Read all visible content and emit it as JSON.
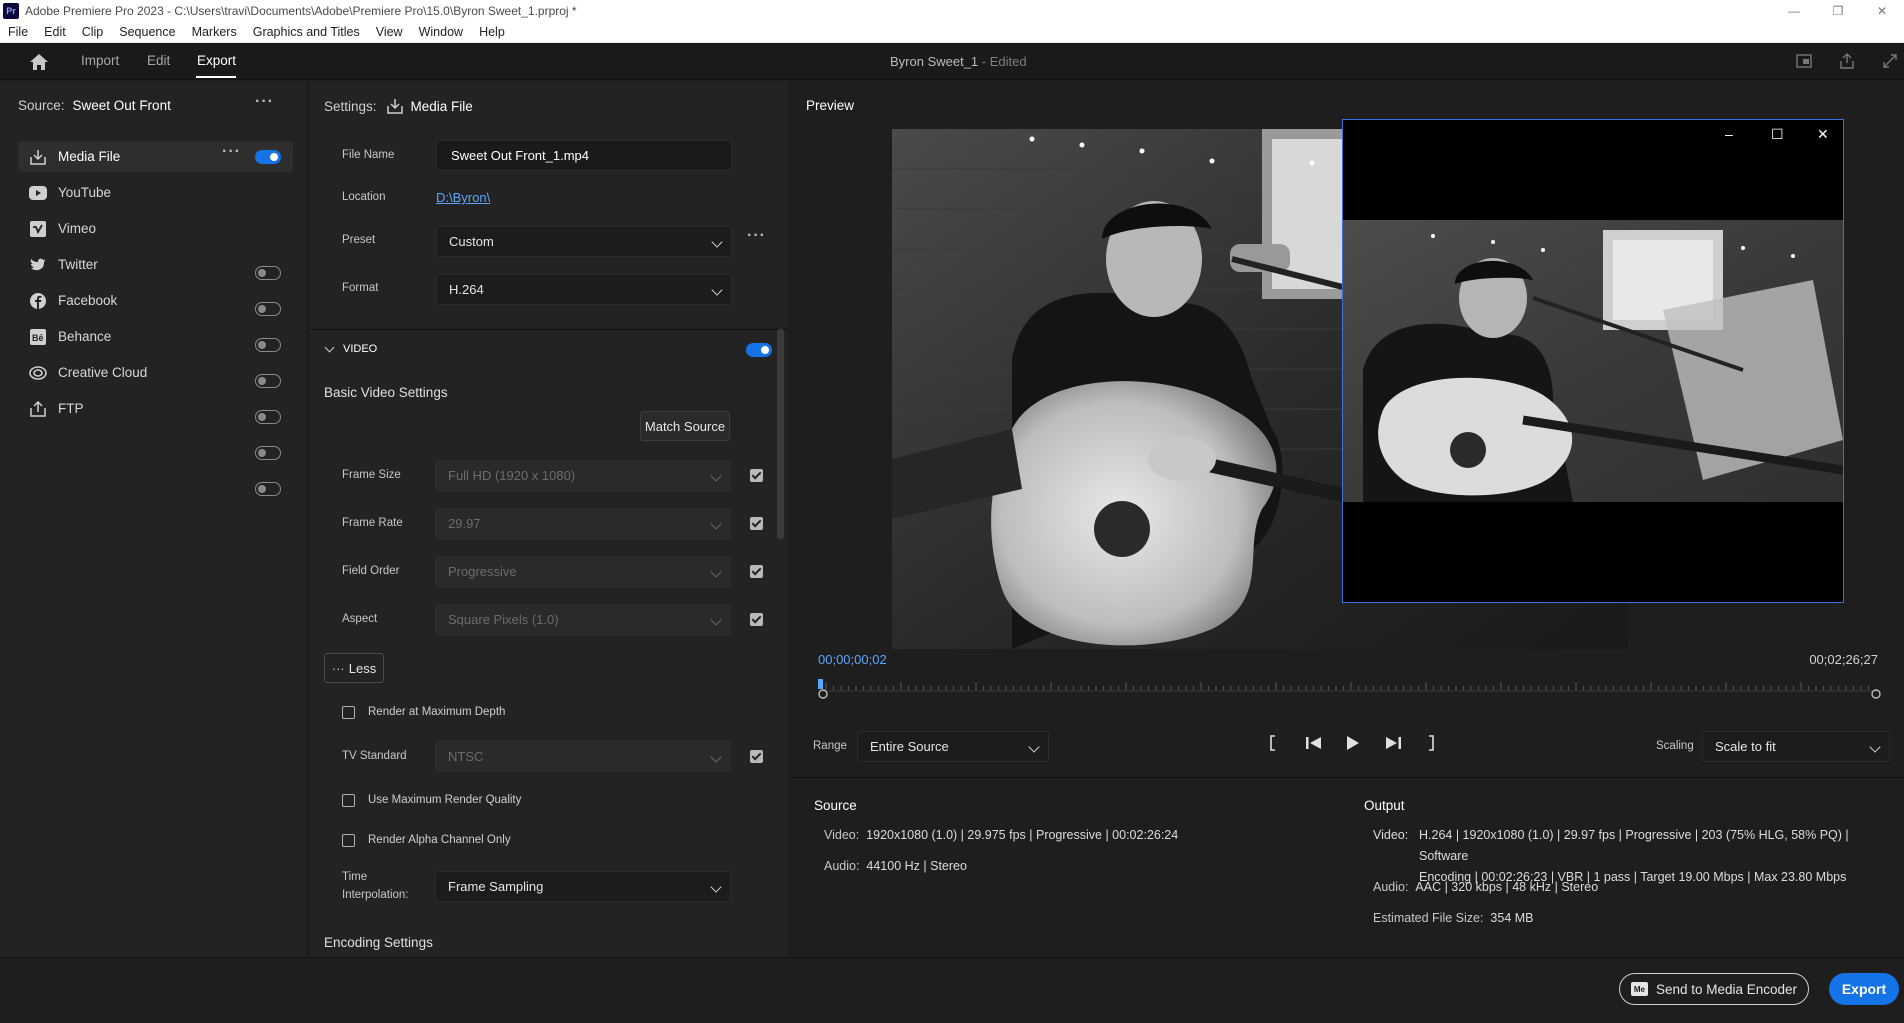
{
  "window": {
    "title": "Adobe Premiere Pro 2023 - C:\\Users\\travi\\Documents\\Adobe\\Premiere Pro\\15.0\\Byron Sweet_1.prproj *",
    "app_badge": "Pr"
  },
  "menu": [
    "File",
    "Edit",
    "Clip",
    "Sequence",
    "Markers",
    "Graphics and Titles",
    "View",
    "Window",
    "Help"
  ],
  "workspace": {
    "tabs": [
      "Import",
      "Edit",
      "Export"
    ],
    "active_tab": "Export",
    "project_name": "Byron Sweet_1",
    "project_status": "- Edited"
  },
  "source_panel": {
    "label": "Source:",
    "name": "Sweet Out Front",
    "destinations": [
      {
        "label": "Media File",
        "icon": "media-file-icon",
        "enabled": true,
        "active": true
      },
      {
        "label": "YouTube",
        "icon": "youtube-icon",
        "enabled": false
      },
      {
        "label": "Vimeo",
        "icon": "vimeo-icon",
        "enabled": false
      },
      {
        "label": "Twitter",
        "icon": "twitter-icon",
        "enabled": false
      },
      {
        "label": "Facebook",
        "icon": "facebook-icon",
        "enabled": false
      },
      {
        "label": "Behance",
        "icon": "behance-icon",
        "enabled": false
      },
      {
        "label": "Creative Cloud",
        "icon": "creative-cloud-icon",
        "enabled": false
      },
      {
        "label": "FTP",
        "icon": "ftp-icon",
        "enabled": false
      }
    ]
  },
  "settings": {
    "header_label": "Settings:",
    "header_value": "Media File",
    "file_name_label": "File Name",
    "file_name": "Sweet Out Front_1.mp4",
    "location_label": "Location",
    "location": "D:\\Byron\\",
    "preset_label": "Preset",
    "preset": "Custom",
    "format_label": "Format",
    "format": "H.264",
    "video_section": "VIDEO",
    "video_enabled": true,
    "basic_video_settings": "Basic Video Settings",
    "match_source": "Match Source",
    "frame_size_label": "Frame Size",
    "frame_size": "Full HD (1920 x 1080)",
    "frame_rate_label": "Frame Rate",
    "frame_rate": "29.97",
    "field_order_label": "Field Order",
    "field_order": "Progressive",
    "aspect_label": "Aspect",
    "aspect": "Square Pixels (1.0)",
    "less_button": "Less",
    "render_max_depth": "Render at Maximum Depth",
    "tv_standard_label": "TV Standard",
    "tv_standard": "NTSC",
    "max_render_quality": "Use Maximum Render Quality",
    "render_alpha": "Render Alpha Channel Only",
    "time_interp_label_1": "Time",
    "time_interp_label_2": "Interpolation:",
    "time_interpolation": "Frame Sampling",
    "encoding_settings": "Encoding Settings"
  },
  "preview": {
    "label": "Preview",
    "current_time": "00;00;00;02",
    "duration": "00;02;26;27",
    "range_label": "Range",
    "range": "Entire Source",
    "scaling_label": "Scaling",
    "scaling": "Scale to fit"
  },
  "source_info": {
    "heading": "Source",
    "video_label": "Video:",
    "video": "1920x1080 (1.0)  |  29.975 fps  |  Progressive  |  00:02:26:24",
    "audio_label": "Audio:",
    "audio": "44100 Hz  |  Stereo"
  },
  "output_info": {
    "heading": "Output",
    "video_label": "Video:",
    "video_line1": "H.264  |  1920x1080 (1.0)  |  29.97 fps  |  Progressive  |  203 (75% HLG, 58% PQ)  |  Software",
    "video_line2": "Encoding  |  00:02:26:23  |  VBR  |  1 pass  |  Target 19.00 Mbps  |  Max 23.80 Mbps",
    "audio_label": "Audio:",
    "audio": "AAC  |  320 kbps  |  48 kHz  |  Stereo",
    "file_size_label": "Estimated File Size:",
    "file_size": "354 MB"
  },
  "footer": {
    "send_to_encoder": "Send to Media Encoder",
    "encoder_badge": "Me",
    "export": "Export"
  },
  "colors": {
    "accent": "#1473e6",
    "timecode": "#5aa7ff",
    "popup_border": "#3d6fe0"
  }
}
